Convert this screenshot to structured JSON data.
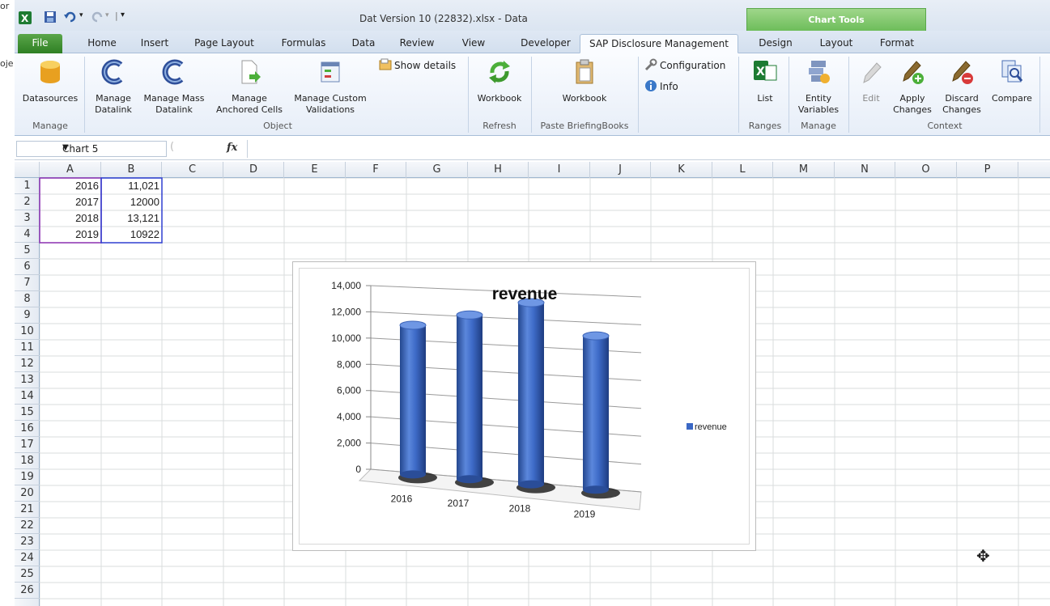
{
  "left_strip": [
    "or",
    "oje"
  ],
  "window": {
    "title": "Dat Version 10 (22832).xlsx  -  Data",
    "chart_tools_label": "Chart Tools"
  },
  "tabs": [
    "File",
    "Home",
    "Insert",
    "Page Layout",
    "Formulas",
    "Data",
    "Review",
    "View",
    "Developer",
    "SAP Disclosure Management",
    "Design",
    "Layout",
    "Format"
  ],
  "ribbon": {
    "datasources": "Datasources",
    "manage_datalink": [
      "Manage",
      "Datalink"
    ],
    "manage_mass_datalink": [
      "Manage Mass",
      "Datalink"
    ],
    "manage_anchored": [
      "Manage",
      "Anchored Cells"
    ],
    "manage_custom": [
      "Manage Custom",
      "Validations"
    ],
    "show_details": "Show details",
    "workbook_refresh": "Workbook",
    "workbook_paste": "Workbook",
    "configuration": "Configuration",
    "info": "Info",
    "list": "List",
    "entity_variables": [
      "Entity",
      "Variables"
    ],
    "edit": "Edit",
    "apply_changes": [
      "Apply",
      "Changes"
    ],
    "discard_changes": [
      "Discard",
      "Changes"
    ],
    "compare": "Compare",
    "groups": {
      "manage": "Manage",
      "object": "Object",
      "refresh": "Refresh",
      "paste": "Paste BriefingBooks",
      "ranges": "Ranges",
      "manage2": "Manage",
      "context": "Context"
    }
  },
  "formula_bar": {
    "name_box": "Chart 5",
    "fx": "fx",
    "formula": ""
  },
  "columns": [
    "A",
    "B",
    "C",
    "D",
    "E",
    "F",
    "G",
    "H",
    "I",
    "J",
    "K",
    "L",
    "M",
    "N",
    "O",
    "P"
  ],
  "rows": [
    "1",
    "2",
    "3",
    "4",
    "5",
    "6",
    "7",
    "8",
    "9",
    "10",
    "11",
    "12",
    "13",
    "14",
    "15",
    "16",
    "17",
    "18",
    "19",
    "20",
    "21",
    "22",
    "23",
    "24",
    "25",
    "26"
  ],
  "cells": [
    {
      "a": "2016",
      "b": "11,021"
    },
    {
      "a": "2017",
      "b": "12000"
    },
    {
      "a": "2018",
      "b": "13,121"
    },
    {
      "a": "2019",
      "b": "10922"
    }
  ],
  "chart_data": {
    "type": "bar",
    "title": "revenue",
    "categories": [
      "2016",
      "2017",
      "2018",
      "2019"
    ],
    "series": [
      {
        "name": "revenue",
        "values": [
          11021,
          12000,
          13121,
          10922
        ],
        "color": "#3b68c5"
      }
    ],
    "yticks": [
      "0",
      "2,000",
      "4,000",
      "6,000",
      "8,000",
      "10,000",
      "12,000",
      "14,000"
    ],
    "ylim": [
      0,
      14000
    ],
    "legend": "right",
    "grid": true
  }
}
